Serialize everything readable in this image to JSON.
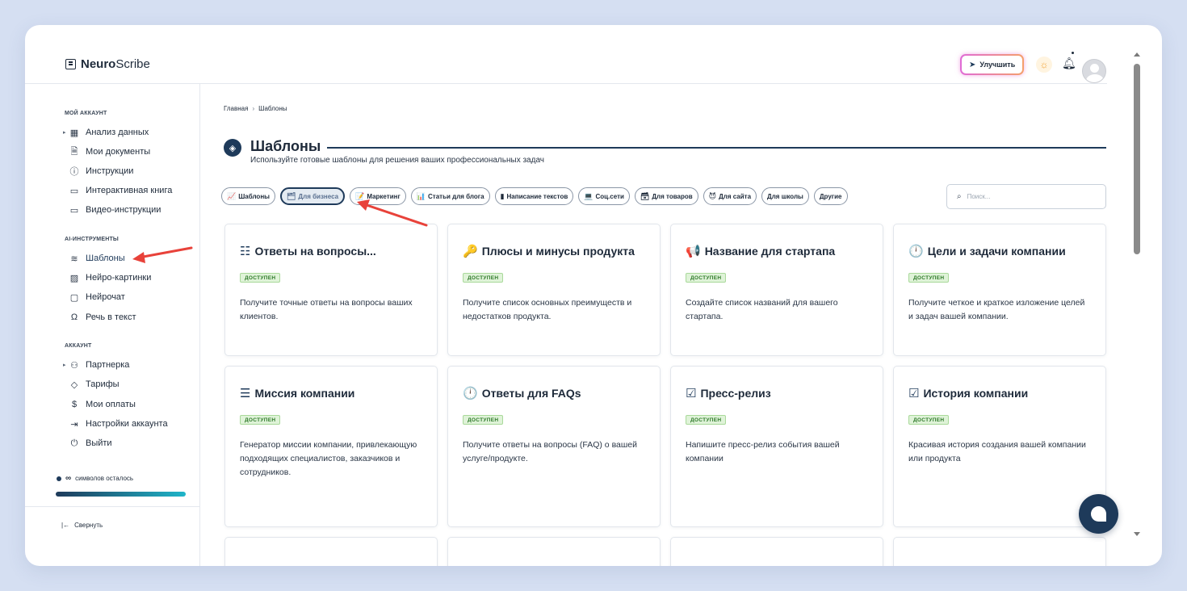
{
  "brand": {
    "name_bold": "Neuro",
    "name_rest": "Scribe"
  },
  "topbar": {
    "upgrade_label": "Улучшить"
  },
  "sidebar": {
    "section_account": "МОЙ АККАУНТ",
    "account_items": [
      {
        "label": "Анализ данных",
        "icon": "grid-icon"
      },
      {
        "label": "Мои документы",
        "icon": "document-icon"
      },
      {
        "label": "Инструкции",
        "icon": "help-icon"
      },
      {
        "label": "Интерактивная книга",
        "icon": "book-icon"
      },
      {
        "label": "Видео-инструкции",
        "icon": "video-icon"
      }
    ],
    "section_ai": "AI-ИНСТРУМЕНТЫ",
    "ai_items": [
      {
        "label": "Шаблоны",
        "icon": "layers-icon"
      },
      {
        "label": "Нейро-картинки",
        "icon": "image-icon"
      },
      {
        "label": "Нейрочат",
        "icon": "chat-icon"
      },
      {
        "label": "Речь в текст",
        "icon": "headphones-icon"
      }
    ],
    "section_acc": "АККАУНТ",
    "acc_items": [
      {
        "label": "Партнерка",
        "icon": "users-icon"
      },
      {
        "label": "Тарифы",
        "icon": "tag-icon"
      },
      {
        "label": "Мои оплаты",
        "icon": "dollar-icon"
      },
      {
        "label": "Настройки аккаунта",
        "icon": "login-icon"
      },
      {
        "label": "Выйти",
        "icon": "power-icon"
      }
    ],
    "credits_symbol": "∞",
    "credits_label": "символов осталось",
    "collapse_label": "Свернуть"
  },
  "breadcrumb": {
    "home": "Главная",
    "current": "Шаблоны"
  },
  "page": {
    "title": "Шаблоны",
    "subtitle": "Используйте готовые шаблоны для решения ваших профессиональных задач"
  },
  "filters": [
    {
      "label": "Шаблоны",
      "icon": "📈",
      "active": false
    },
    {
      "label": "Для бизнеса",
      "icon": "🗂",
      "active": true
    },
    {
      "label": "Маркетинг",
      "icon": "📝",
      "active": false
    },
    {
      "label": "Статьи для блога",
      "icon": "📊",
      "active": false
    },
    {
      "label": "Написание текстов",
      "icon": "▮",
      "active": false
    },
    {
      "label": "Соц.сети",
      "icon": "💻",
      "active": false
    },
    {
      "label": "Для товаров",
      "icon": "🗃",
      "active": false
    },
    {
      "label": "Для сайта",
      "icon": "😈",
      "active": false
    },
    {
      "label": "Для школы",
      "icon": "",
      "active": false
    },
    {
      "label": "Другие",
      "icon": "",
      "active": false
    }
  ],
  "search": {
    "placeholder": "Поиск..."
  },
  "cards": [
    {
      "title": "Ответы на вопросы...",
      "icon": "☷",
      "badge": "ДОСТУПЕН",
      "desc": "Получите точные ответы на вопросы ваших клиентов."
    },
    {
      "title": "Плюсы и минусы продукта",
      "icon": "🔑",
      "badge": "ДОСТУПЕН",
      "desc": "Получите список основных преимуществ и недостатков продукта."
    },
    {
      "title": "Название для стартапа",
      "icon": "📢",
      "badge": "ДОСТУПЕН",
      "desc": "Создайте список названий для вашего стартапа."
    },
    {
      "title": "Цели и задачи компании",
      "icon": "🕛",
      "badge": "ДОСТУПЕН",
      "desc": "Получите четкое и краткое изложение целей и задач вашей компании."
    },
    {
      "title": "Миссия компании",
      "icon": "☰",
      "badge": "ДОСТУПЕН",
      "desc": "Генератор миссии компании, привлекающую подходящих специалистов, заказчиков и сотрудников."
    },
    {
      "title": "Ответы для FAQs",
      "icon": "🕛",
      "badge": "ДОСТУПЕН",
      "desc": "Получите ответы на вопросы (FAQ) о вашей услуге/продукте."
    },
    {
      "title": "Пресс-релиз",
      "icon": "☑",
      "badge": "ДОСТУПЕН",
      "desc": "Напишите пресс-релиз события вашей компании"
    },
    {
      "title": "История компании",
      "icon": "☑",
      "badge": "ДОСТУПЕН",
      "desc": "Красивая история создания вашей компании или продукта"
    }
  ],
  "colors": {
    "primary": "#1e3a5a",
    "accent_teal": "#1fb5c9",
    "badge_green": "#dff3d8",
    "annotation_red": "#e8423a"
  }
}
